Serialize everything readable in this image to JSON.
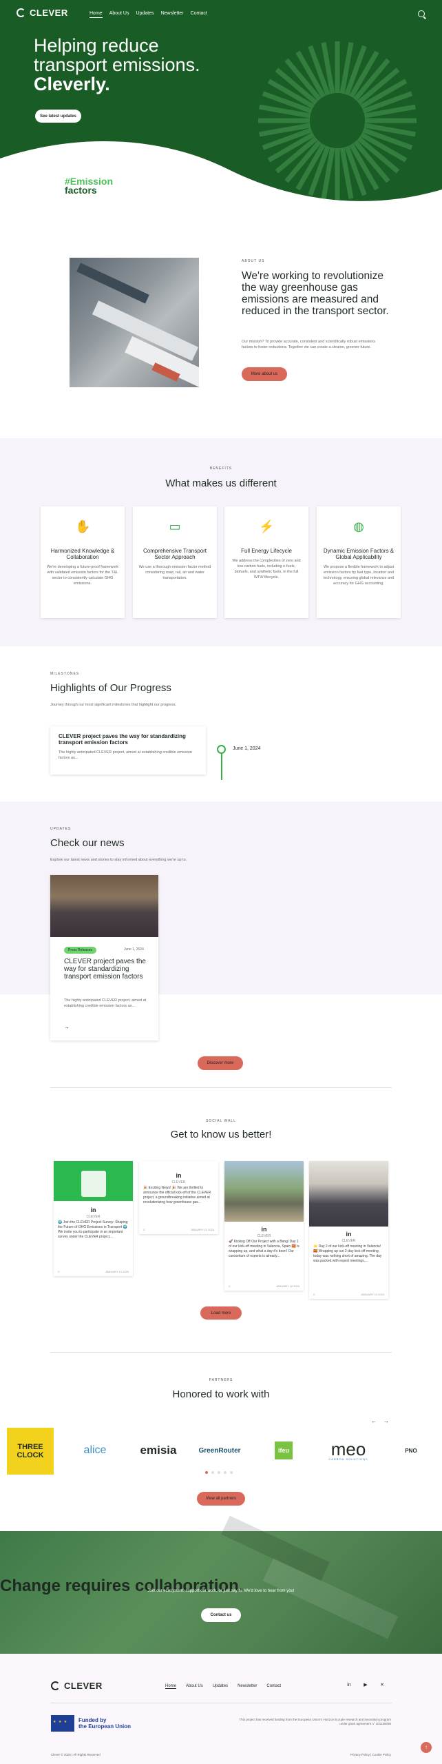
{
  "header": {
    "brand": "CLEVER",
    "nav": [
      "Home",
      "About Us",
      "Updates",
      "Newsletter",
      "Contact"
    ]
  },
  "hero": {
    "line1": "Helping reduce",
    "line2": "transport emissions.",
    "line3": "Cleverly.",
    "cta": "See latest updates",
    "tag_hash": "#Emission",
    "tag_word": "factors"
  },
  "about": {
    "eyebrow": "ABOUT US",
    "heading": "We're working to revolutionize the way greenhouse gas emissions are measured and reduced in the transport sector.",
    "body": "Our mission? To provide accurate, consistent and scientifically robust emissions factors to foster reductions. Together we can create a cleaner, greener future.",
    "cta": "More about us"
  },
  "benefits": {
    "eyebrow": "BENEFITS",
    "title": "What makes us different",
    "cards": [
      {
        "icon": "handshake-icon",
        "title": "Harmonized Knowledge & Collaboration",
        "text": "We're developing a future-proof framework with validated emission factors for the T&L sector to consistently calculate GHG emissions."
      },
      {
        "icon": "truck-icon",
        "title": "Comprehensive Transport Sector Approach",
        "text": "We use a thorough emission factor method considering road, rail, air and water transportation."
      },
      {
        "icon": "lightning-icon",
        "title": "Full Energy Lifecycle",
        "text": "We address the complexities of zero and low-carbon fuels, including e-fuels, biofuels, and synthetic fuels, in the full WTW lifecycle."
      },
      {
        "icon": "globe-icon",
        "title": "Dynamic Emission Factors & Global Applicability",
        "text": "We propose a flexible framework to adjust emission factors by fuel type, location and technology, ensuring global relevance and accuracy for GHG accounting."
      }
    ]
  },
  "milestones": {
    "eyebrow": "MILESTONES",
    "title": "Highlights of Our Progress",
    "subtitle": "Journey through our most significant milestones that highlight our progress.",
    "item": {
      "title": "CLEVER project paves the way for standardizing transport emission factors",
      "text": "The highly anticipated CLEVER project, aimed at establishing credible emission factors as...",
      "date": "June 1, 2024"
    }
  },
  "updates": {
    "eyebrow": "UPDATES",
    "title": "Check our news",
    "subtitle": "Explore our latest news and stories to stay informed about everything we're up to.",
    "news": {
      "tag": "Press Releases",
      "date": "June 1, 2024",
      "title": "CLEVER project paves the way for standardizing transport emission factors",
      "text": "The highly anticipated CLEVER project, aimed at establishing credible emission factors as...",
      "arrow": "→"
    },
    "cta": "Discover more"
  },
  "social": {
    "eyebrow": "SOCIAL WALL",
    "title": "Get to know us better!",
    "network": "in",
    "name": "CLEVER",
    "posts": [
      {
        "text": "🌍 Join the CLEVER Project Survey: Shaping the Future of GHG Emissions in Transport 🌍 We invite you to participate in an important survey under the CLEVER project,...",
        "footer": "JANUARY 14 2025"
      },
      {
        "text": "🎉 Exciting News! 🎉 We are thrilled to announce the official kick-off of the CLEVER project, a groundbreaking initiative aimed at revolutionizing how greenhouse gas...",
        "footer": "JANUARY 10 2024"
      },
      {
        "text": "🚀 Kicking Off Our Project with a Bang! Day 1 of our kick-off meeting in Valencia, Spain 🇪🇸 is wrapping up, and what a day it's been! Our consortium of experts is already...",
        "footer": "JANUARY 10 2024"
      },
      {
        "text": "🌟 Day 2 of our kick-off meeting in Valencia! 🇪🇸 Wrapping up our 2-day kick-off meeting, today was nothing short of amazing. The day was packed with expert meetings,...",
        "footer": "JANUARY 10 2024"
      }
    ],
    "cta": "Load more"
  },
  "partners": {
    "eyebrow": "PARTNERS",
    "title": "Honored to work with",
    "logos": [
      "THREE CLOCK",
      "alice",
      "emisia",
      "GreenRouter",
      "ifeu",
      "meo",
      "PNO"
    ],
    "meo_sub": "CARBON SOLUTIONS",
    "cta": "View all partners",
    "prev": "←",
    "next": "→"
  },
  "collab": {
    "title": "Change requires collaboration.",
    "subtitle": "Join our ecosystem, support our work, or just say hi. We'd love to hear from you!",
    "cta": "Contact us"
  },
  "footer": {
    "brand": "CLEVER",
    "nav": [
      "Home",
      "About Us",
      "Updates",
      "Newsletter",
      "Contact"
    ],
    "eu_line1": "Funded by",
    "eu_line2": "the European Union",
    "funding_text": "This project has received funding from the European Union's Horizon Europe research and innovation program under grant agreement n° 101136036",
    "copyright": "Clever © 2025 | All Rights Reserved",
    "legal": "Privacy Policy | Cookie Policy",
    "to_top": "↑"
  },
  "colors": {
    "brand_green": "#1a5c26",
    "accent_orange": "#d9695a",
    "accent_lime": "#4cc05a"
  }
}
